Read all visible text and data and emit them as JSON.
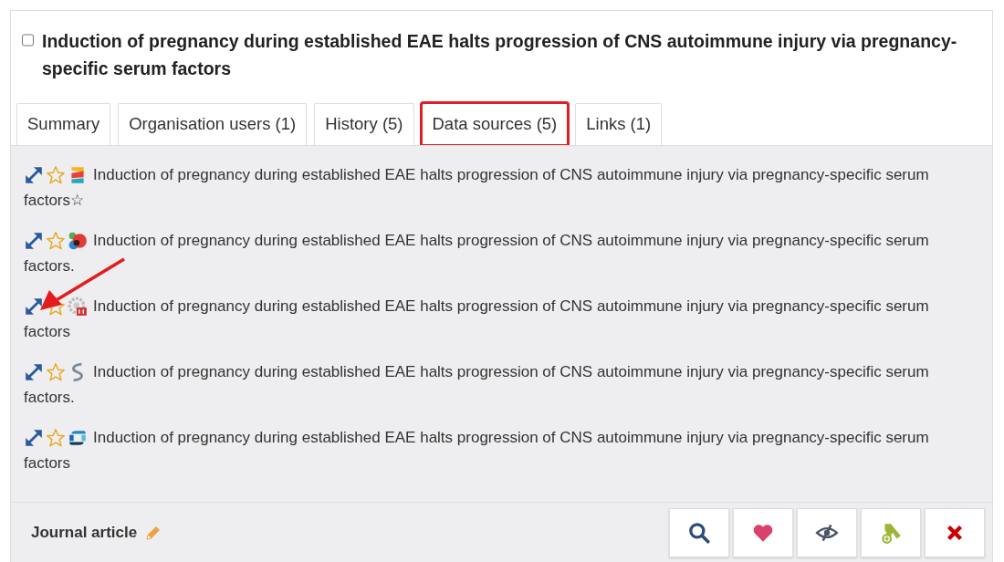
{
  "record": {
    "title": "Induction of pregnancy during established EAE halts progression of CNS autoimmune injury via pregnancy-specific serum factors",
    "checked": false
  },
  "tabs": [
    {
      "label": "Summary",
      "selected": false
    },
    {
      "label": "Organisation users (1)",
      "selected": false
    },
    {
      "label": "History (5)",
      "selected": false
    },
    {
      "label": "Data sources (5)",
      "selected": true
    },
    {
      "label": "Links (1)",
      "selected": false
    }
  ],
  "sources": [
    {
      "kind": "stripes",
      "starred": false,
      "title": "Induction of pregnancy during established EAE halts progression of CNS autoimmune injury via pregnancy-specific serum factors☆"
    },
    {
      "kind": "circles",
      "starred": false,
      "title": "Induction of pregnancy during established EAE halts progression of CNS autoimmune injury via pregnancy-specific serum factors."
    },
    {
      "kind": "gear",
      "starred": false,
      "title": "Induction of pregnancy during established EAE halts progression of CNS autoimmune injury via pregnancy-specific serum factors"
    },
    {
      "kind": "swirl",
      "starred": false,
      "title": "Induction of pregnancy during established EAE halts progression of CNS autoimmune injury via pregnancy-specific serum factors."
    },
    {
      "kind": "ring",
      "starred": false,
      "title": "Induction of pregnancy during established EAE halts progression of CNS autoimmune injury via pregnancy-specific serum factors"
    }
  ],
  "pointer_arrow": true,
  "footer": {
    "type_label": "Journal article",
    "actions": [
      {
        "kind": "search"
      },
      {
        "kind": "favourite"
      },
      {
        "kind": "hide"
      },
      {
        "kind": "bookmark"
      },
      {
        "kind": "delete"
      }
    ]
  }
}
